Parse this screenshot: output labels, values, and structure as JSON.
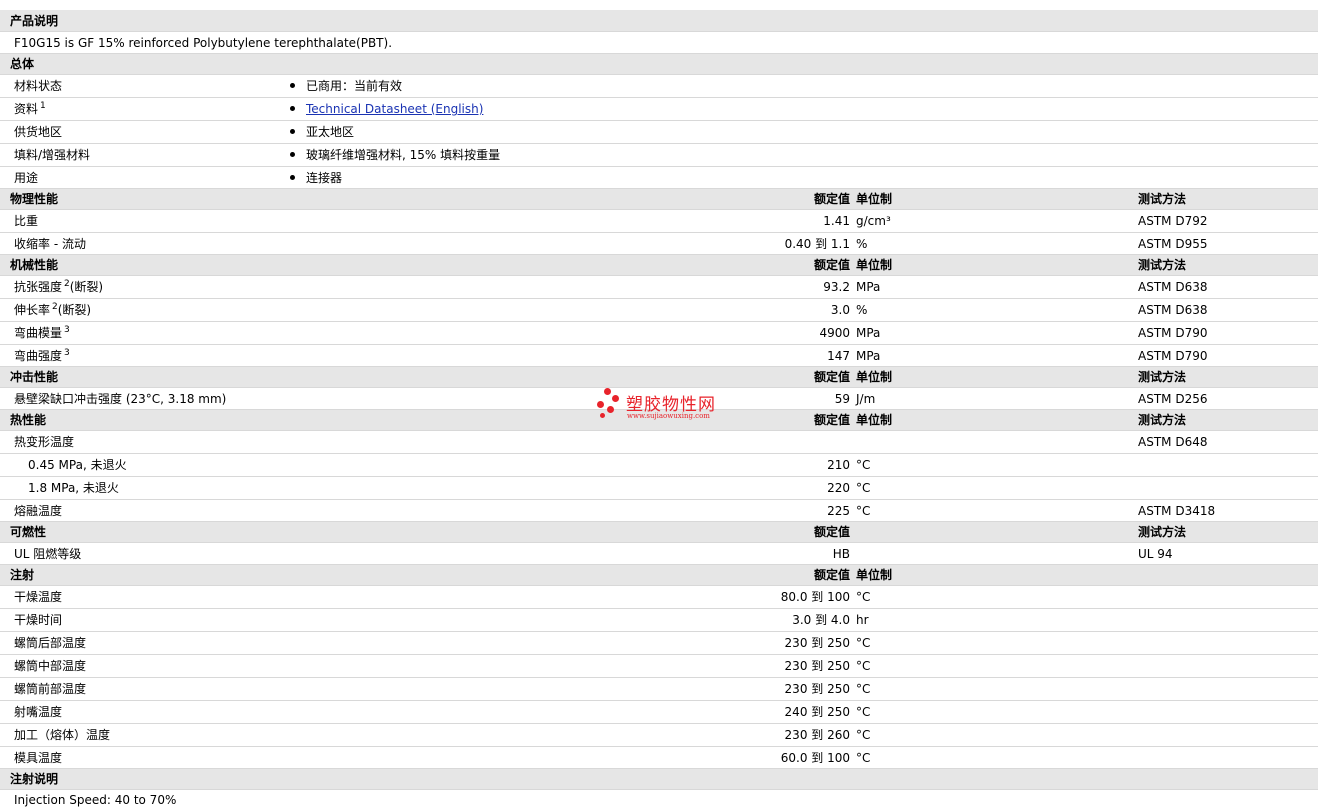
{
  "sections": {
    "product_desc": {
      "title": "产品说明",
      "text": "F10G15 is GF 15% reinforced Polybutylene terephthalate(PBT)."
    },
    "general": {
      "title": "总体",
      "rows": [
        {
          "label": "材料状态",
          "value": "已商用：当前有效"
        },
        {
          "label": "资料",
          "sup": "1",
          "value": "Technical Datasheet (English)"
        },
        {
          "label": "供货地区",
          "value": "亚太地区"
        },
        {
          "label": "填料/增强材料",
          "value": "玻璃纤维增强材料, 15% 填料按重量"
        },
        {
          "label": "用途",
          "value": "连接器"
        }
      ]
    },
    "col_headers": {
      "nominal": "额定值",
      "unit": "单位制",
      "test": "测试方法"
    },
    "physical": {
      "title": "物理性能",
      "rows": [
        {
          "label": "比重",
          "value": "1.41",
          "unit": "g/cm³",
          "test": "ASTM D792"
        },
        {
          "label": "收缩率  - 流动",
          "value": "0.40 到  1.1",
          "unit": "%",
          "test": "ASTM D955"
        }
      ]
    },
    "mechanical": {
      "title": "机械性能",
      "rows": [
        {
          "label": "抗张强度",
          "sup": "2",
          "suffix": "(断裂)",
          "value": "93.2",
          "unit": "MPa",
          "test": "ASTM D638"
        },
        {
          "label": "伸长率",
          "sup": "2",
          "suffix": "(断裂)",
          "value": "3.0",
          "unit": "%",
          "test": "ASTM D638"
        },
        {
          "label": "弯曲模量",
          "sup": "3",
          "suffix": "",
          "value": "4900",
          "unit": "MPa",
          "test": "ASTM D790"
        },
        {
          "label": "弯曲强度",
          "sup": "3",
          "suffix": "",
          "value": "147",
          "unit": "MPa",
          "test": "ASTM D790"
        }
      ]
    },
    "impact": {
      "title": "冲击性能",
      "rows": [
        {
          "label": "悬壁梁缺口冲击强度  (23°C, 3.18 mm)",
          "value": "59",
          "unit": "J/m",
          "test": "ASTM D256"
        }
      ]
    },
    "thermal": {
      "title": "热性能",
      "rows": [
        {
          "label": "热变形温度",
          "value": "",
          "unit": "",
          "test": "ASTM D648"
        },
        {
          "label": "0.45 MPa, 未退火",
          "value": "210",
          "unit": "°C",
          "test": ""
        },
        {
          "label": "1.8 MPa, 未退火",
          "value": "220",
          "unit": "°C",
          "test": ""
        },
        {
          "label": "熔融温度",
          "value": "225",
          "unit": "°C",
          "test": "ASTM D3418"
        }
      ]
    },
    "flammability": {
      "title": "可燃性",
      "rows": [
        {
          "label": "UL 阻燃等级",
          "value": "HB",
          "unit": "",
          "test": "UL 94"
        }
      ]
    },
    "injection": {
      "title": "注射",
      "rows": [
        {
          "label": "干燥温度",
          "value": "80.0 到  100",
          "unit": "°C"
        },
        {
          "label": "干燥时间",
          "value": "3.0 到  4.0",
          "unit": "hr"
        },
        {
          "label": "螺筒后部温度",
          "value": "230 到  250",
          "unit": "°C"
        },
        {
          "label": "螺筒中部温度",
          "value": "230 到  250",
          "unit": "°C"
        },
        {
          "label": "螺筒前部温度",
          "value": "230 到  250",
          "unit": "°C"
        },
        {
          "label": "射嘴温度",
          "value": "240 到  250",
          "unit": "°C"
        },
        {
          "label": "加工（熔体）温度",
          "value": "230 到  260",
          "unit": "°C"
        },
        {
          "label": "模具温度",
          "value": "60.0 到  100",
          "unit": "°C"
        }
      ]
    },
    "injection_notes": {
      "title": "注射说明",
      "text": "Injection Speed: 40 to 70%"
    }
  },
  "watermark": {
    "text": "塑胶物性网",
    "url": "www.sujiaowuxing.com",
    "color": "#e8232b"
  }
}
